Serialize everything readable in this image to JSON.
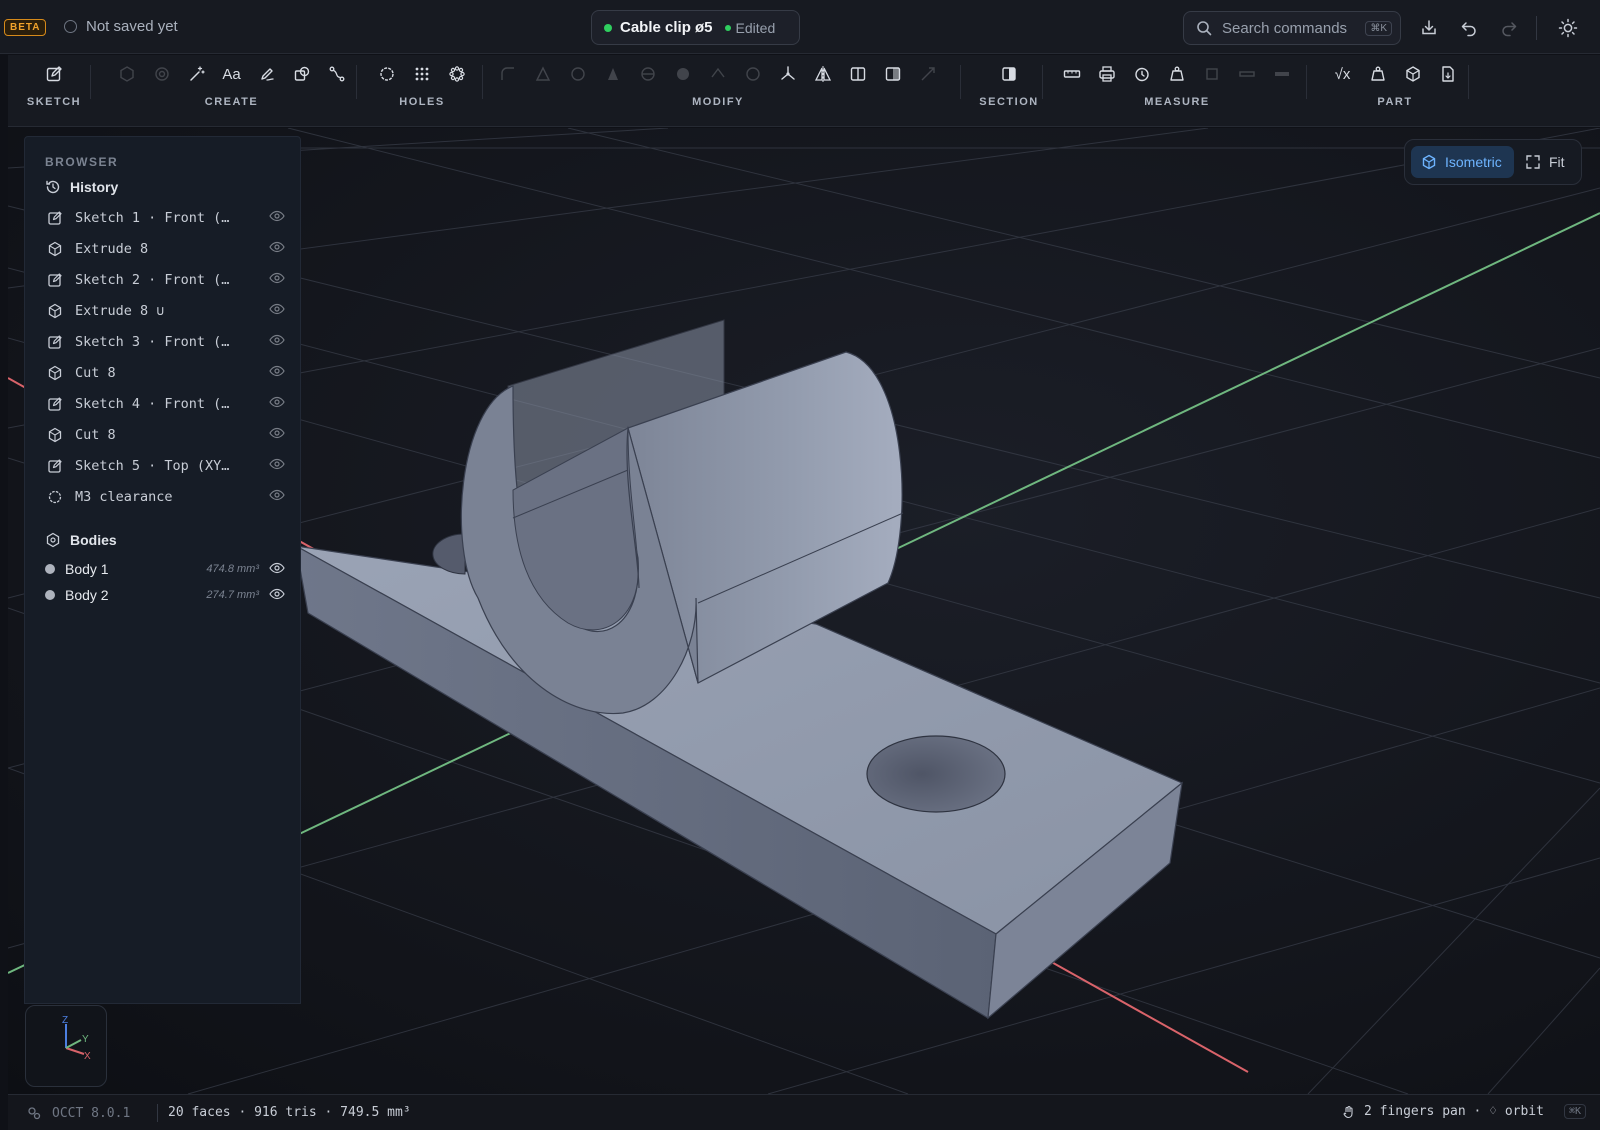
{
  "topbar": {
    "beta_badge": "BETA",
    "save_status": "Not saved yet",
    "document_name": "Cable clip ø5",
    "edited_label": "Edited",
    "search_placeholder": "Search commands",
    "search_shortcut": "⌘K",
    "icons": [
      "download-icon",
      "undo-icon",
      "redo-icon",
      "theme-sun-icon"
    ]
  },
  "toolbar": {
    "groups": [
      {
        "label": "SKETCH"
      },
      {
        "label": "CREATE"
      },
      {
        "label": "HOLES"
      },
      {
        "label": "MODIFY"
      },
      {
        "label": "SECTION"
      },
      {
        "label": "MEASURE"
      },
      {
        "label": "PART"
      }
    ],
    "text_tool": "Aa",
    "sqrt_tool": "√x"
  },
  "browser": {
    "title": "BROWSER",
    "history_label": "History",
    "history": [
      {
        "label": "Sketch 1 · Front (…",
        "icon": "sketch-icon"
      },
      {
        "label": "Extrude 8",
        "icon": "extrude-icon"
      },
      {
        "label": "Sketch 2 · Front (…",
        "icon": "sketch-icon"
      },
      {
        "label": "Extrude 8 ∪",
        "icon": "extrude-icon"
      },
      {
        "label": "Sketch 3 · Front (…",
        "icon": "sketch-icon"
      },
      {
        "label": "Cut 8",
        "icon": "cut-icon"
      },
      {
        "label": "Sketch 4 · Front (…",
        "icon": "sketch-icon"
      },
      {
        "label": "Cut 8",
        "icon": "cut-icon"
      },
      {
        "label": "Sketch 5 · Top (XY…",
        "icon": "sketch-icon"
      },
      {
        "label": "M3 clearance",
        "icon": "hole-icon"
      }
    ],
    "bodies_label": "Bodies",
    "bodies": [
      {
        "name": "Body 1",
        "volume": "474.8 mm³"
      },
      {
        "name": "Body 2",
        "volume": "274.7 mm³"
      }
    ]
  },
  "view_controls": {
    "isometric_label": "Isometric",
    "fit_label": "Fit"
  },
  "gizmo": {
    "z": "Z",
    "y": "Y",
    "x": "X"
  },
  "statusbar": {
    "engine": "OCCT 8.0.1",
    "stats": "20 faces · 916 tris · 749.5 mm³",
    "hint": "2 fingers pan · ♢ orbit",
    "shortcut": "⌘K"
  },
  "colors": {
    "accent": "#6eb4ff",
    "x_axis": "#d9636a",
    "y_axis": "#6fb77f",
    "z_axis": "#4c7fe0",
    "body": "#8a93a5"
  }
}
